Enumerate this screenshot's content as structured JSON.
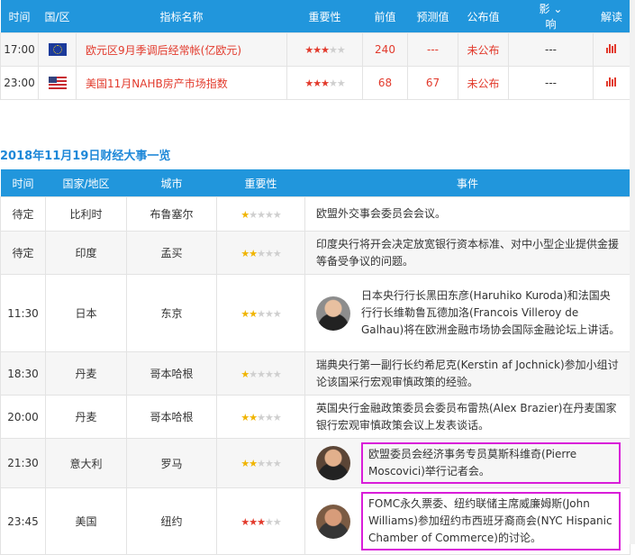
{
  "indicators": {
    "headers": [
      "时间",
      "国/区",
      "指标名称",
      "重要性",
      "前值",
      "预测值",
      "公布值",
      "影响",
      "解读"
    ],
    "rows": [
      {
        "time": "17:00",
        "flag": "eu-flag",
        "name": "欧元区9月季调后经常帐(亿欧元)",
        "stars": 3,
        "prev": "240",
        "forecast": "---",
        "actual": "未公布",
        "impact": "---",
        "icon": "chart-icon"
      },
      {
        "time": "23:00",
        "flag": "us-flag",
        "name": "美国11月NAHB房产市场指数",
        "stars": 3,
        "prev": "68",
        "forecast": "67",
        "actual": "未公布",
        "impact": "---",
        "icon": "chart-icon"
      }
    ]
  },
  "events": {
    "title": "2018年11月19日财经大事一览",
    "headers": [
      "时间",
      "国家/地区",
      "城市",
      "重要性",
      "事件"
    ],
    "rows": [
      {
        "time": "待定",
        "country": "比利时",
        "city": "布鲁塞尔",
        "stars": 1,
        "text": "欧盟外交事会委员会会议。",
        "avatar": "",
        "boxed": false,
        "red": false
      },
      {
        "time": "待定",
        "country": "印度",
        "city": "孟买",
        "stars": 2,
        "text": "印度央行将开会决定放宽银行资本标准、对中小型企业提供金援等备受争议的问题。",
        "avatar": "",
        "boxed": false,
        "red": false
      },
      {
        "time": "11:30",
        "country": "日本",
        "city": "东京",
        "stars": 2,
        "text": "日本央行行长黑田东彦(Haruhiko Kuroda)和法国央行行长维勒鲁瓦德加洛(Francois Villeroy de Galhau)将在欧洲金融市场协会国际金融论坛上讲话。",
        "avatar": "kuroda-avatar",
        "boxed": false,
        "red": false
      },
      {
        "time": "18:30",
        "country": "丹麦",
        "city": "哥本哈根",
        "stars": 1,
        "text": "瑞典央行第一副行长约希尼克(Kerstin af Jochnick)参加小组讨论该国采行宏观审慎政策的经验。",
        "avatar": "",
        "boxed": false,
        "red": false
      },
      {
        "time": "20:00",
        "country": "丹麦",
        "city": "哥本哈根",
        "stars": 2,
        "text": "英国央行金融政策委员会委员布雷热(Alex Brazier)在丹麦国家银行宏观审慎政策会议上发表谈话。",
        "avatar": "",
        "boxed": false,
        "red": false
      },
      {
        "time": "21:30",
        "country": "意大利",
        "city": "罗马",
        "stars": 2,
        "text": "欧盟委员会经济事务专员莫斯科维奇(Pierre Moscovici)举行记者会。",
        "avatar": "moscovici-avatar",
        "boxed": true,
        "red": false
      },
      {
        "time": "23:45",
        "country": "美国",
        "city": "纽约",
        "stars": 3,
        "text": "FOMC永久票委、纽约联储主席威廉姆斯(John Williams)参加纽约市西班牙裔商会(NYC Hispanic Chamber of Commerce)的讨论。",
        "avatar": "williams-avatar",
        "boxed": true,
        "red": true
      }
    ]
  },
  "colors": {
    "header": "#2196dc",
    "accent": "#e23a2c",
    "highlight": "#d91dd9"
  }
}
